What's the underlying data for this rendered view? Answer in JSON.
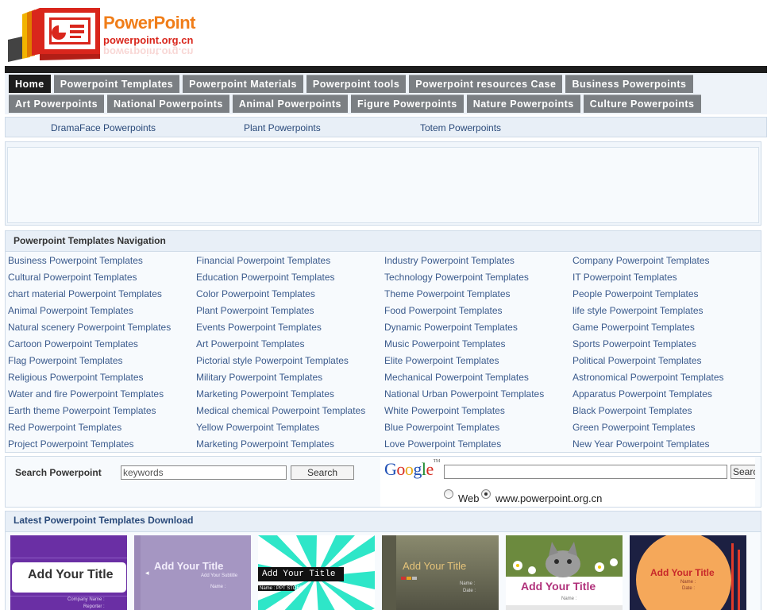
{
  "logo": {
    "title": "PowerPoint",
    "url": "powerpoint.org.cn",
    "colors": {
      "title": "#f07e1a",
      "url": "#d9261c",
      "book": "#d9261c"
    }
  },
  "nav": {
    "row1": [
      "Home",
      "Powerpoint Templates",
      "Powerpoint Materials",
      "Powerpoint tools",
      "Powerpoint resources Case",
      "Business Powerpoints"
    ],
    "row2": [
      "Art Powerpoints",
      "National Powerpoints",
      "Animal Powerpoints",
      "Figure Powerpoints",
      "Nature Powerpoints",
      "Culture Powerpoints"
    ],
    "active": "Home"
  },
  "subnav": [
    "DramaFace Powerpoints",
    "Plant Powerpoints",
    "Totem Powerpoints"
  ],
  "categories": {
    "heading": "Powerpoint Templates Navigation",
    "items": [
      "Business Powerpoint Templates",
      "Financial Powerpoint Templates",
      "Industry Powerpoint Templates",
      "Company Powerpoint Templates",
      "Cultural Powerpoint Templates",
      "Education Powerpoint Templates",
      "Technology Powerpoint Templates",
      "IT Powerpoint Templates",
      "chart material Powerpoint Templates",
      "Color Powerpoint Templates",
      "Theme Powerpoint Templates",
      "People Powerpoint Templates",
      "Animal Powerpoint Templates",
      "Plant Powerpoint Templates",
      "Food Powerpoint Templates",
      "life style Powerpoint Templates",
      "Natural scenery Powerpoint Templates",
      "Events Powerpoint Templates",
      "Dynamic Powerpoint Templates",
      "Game Powerpoint Templates",
      "Cartoon Powerpoint Templates",
      "Art Powerpoint Templates",
      "Music Powerpoint Templates",
      "Sports Powerpoint Templates",
      "Flag Powerpoint Templates",
      "Pictorial style Powerpoint Templates",
      "Elite Powerpoint Templates",
      "Political Powerpoint Templates",
      "Religious Powerpoint Templates",
      "Military Powerpoint Templates",
      "Mechanical Powerpoint Templates",
      "Astronomical Powerpoint Templates",
      "Water and fire Powerpoint Templates",
      "Marketing Powerpoint Templates",
      "National Urban Powerpoint Templates",
      "Apparatus Powerpoint Templates",
      "Earth theme Powerpoint Templates",
      "Medical chemical Powerpoint Templates",
      "White Powerpoint Templates",
      "Black Powerpoint Templates",
      "Red Powerpoint Templates",
      "Yellow Powerpoint Templates",
      "Blue Powerpoint Templates",
      "Green Powerpoint Templates",
      "Project Powerpoint Templates",
      "Marketing Powerpoint Templates",
      "Love Powerpoint Templates",
      "New Year Powerpoint Templates"
    ]
  },
  "search": {
    "label": "Search Powerpoint",
    "placeholder": "keywords",
    "button": "Search",
    "google_button": "Search",
    "radio_web": "Web",
    "radio_site": "www.powerpoint.org.cn",
    "selected": "www.powerpoint.org.cn"
  },
  "latest": {
    "heading": "Latest Powerpoint Templates Download",
    "thumbs": [
      {
        "title": "Add Your Title",
        "sub1": "Company Name :",
        "sub2": "Reporter :",
        "bg": "#6a2fa4"
      },
      {
        "title": "Add Your Title",
        "sub1": "Add Your Subtitle",
        "sub2": "Name :",
        "bg": "#a596c2"
      },
      {
        "title": "Add Your Title",
        "sub1": "Name : PPT STORE",
        "sub2": "",
        "bg": "#2ee6c8"
      },
      {
        "title": "Add Your Title",
        "sub1": "Name :",
        "sub2": "Date :",
        "bg": "#6e6e5a"
      },
      {
        "title": "Add Your Title",
        "sub1": "Name :",
        "sub2": "",
        "bg": "#ffffff"
      },
      {
        "title": "Add Your Title",
        "sub1": "Name :",
        "sub2": "Date :",
        "bg": "#1c2042"
      }
    ]
  }
}
